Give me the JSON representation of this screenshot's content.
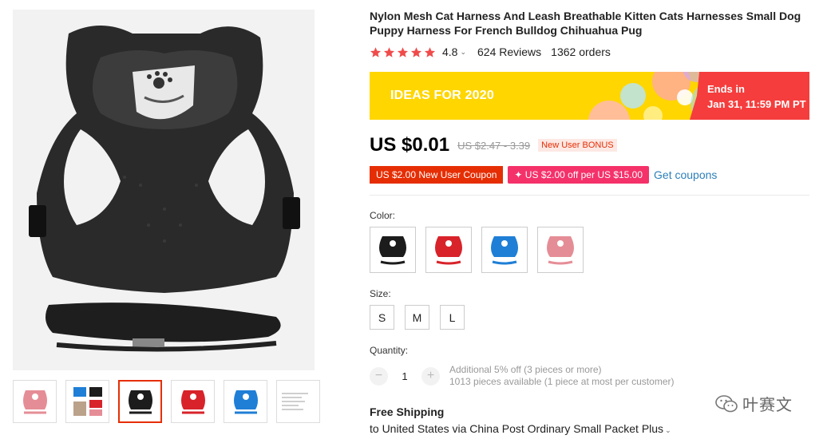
{
  "product": {
    "title": "Nylon Mesh Cat Harness And Leash Breathable Kitten Cats Harnesses Small Dog Puppy Harness For French Bulldog Chihuahua Pug",
    "rating": "4.8",
    "reviews": "624 Reviews",
    "orders": "1362 orders",
    "rating_value": 4.8,
    "star_color": "#f04b4b"
  },
  "banner": {
    "text": "IDEAS FOR 2020",
    "ends_label": "Ends in",
    "ends_time": "Jan 31, 11:59 PM PT",
    "bg_color": "#ffd600",
    "end_color": "#f53d3d"
  },
  "price": {
    "current": "US $0.01",
    "original": "US $2.47 - 3.39",
    "tag": "New User BONUS"
  },
  "coupons": {
    "new_user": "US $2.00 New User Coupon",
    "store": "✦ US $2.00 off per US $15.00",
    "get_link": "Get coupons"
  },
  "color": {
    "label": "Color:",
    "options": [
      {
        "icon": "black-harness-thumbnail",
        "hex": "#1c1c1c"
      },
      {
        "icon": "red-harness-thumbnail",
        "hex": "#d8232a"
      },
      {
        "icon": "blue-harness-thumbnail",
        "hex": "#1f7fd6"
      },
      {
        "icon": "pink-harness-thumbnail",
        "hex": "#e58d96"
      }
    ]
  },
  "size": {
    "label": "Size:",
    "options": [
      "S",
      "M",
      "L"
    ]
  },
  "quantity": {
    "label": "Quantity:",
    "value": "1",
    "minus": "−",
    "plus": "+",
    "discount": "Additional 5% off (3 pieces or more)",
    "available": "1013 pieces available (1 piece at most per customer)"
  },
  "shipping": {
    "title": "Free Shipping",
    "desc": "to United States via China Post Ordinary Small Packet Plus"
  },
  "watermark": {
    "text": "叶赛文",
    "icon": "wechat-icon"
  },
  "gallery": {
    "main_icon": "black-harness-product-photo",
    "thumbnails": [
      "pink-harness-thumbnail",
      "multi-color-harness-thumbnail",
      "black-harness-thumbnail",
      "red-harness-thumbnail",
      "blue-harness-thumbnail",
      "size-chart-thumbnail"
    ],
    "active_index": 2
  }
}
